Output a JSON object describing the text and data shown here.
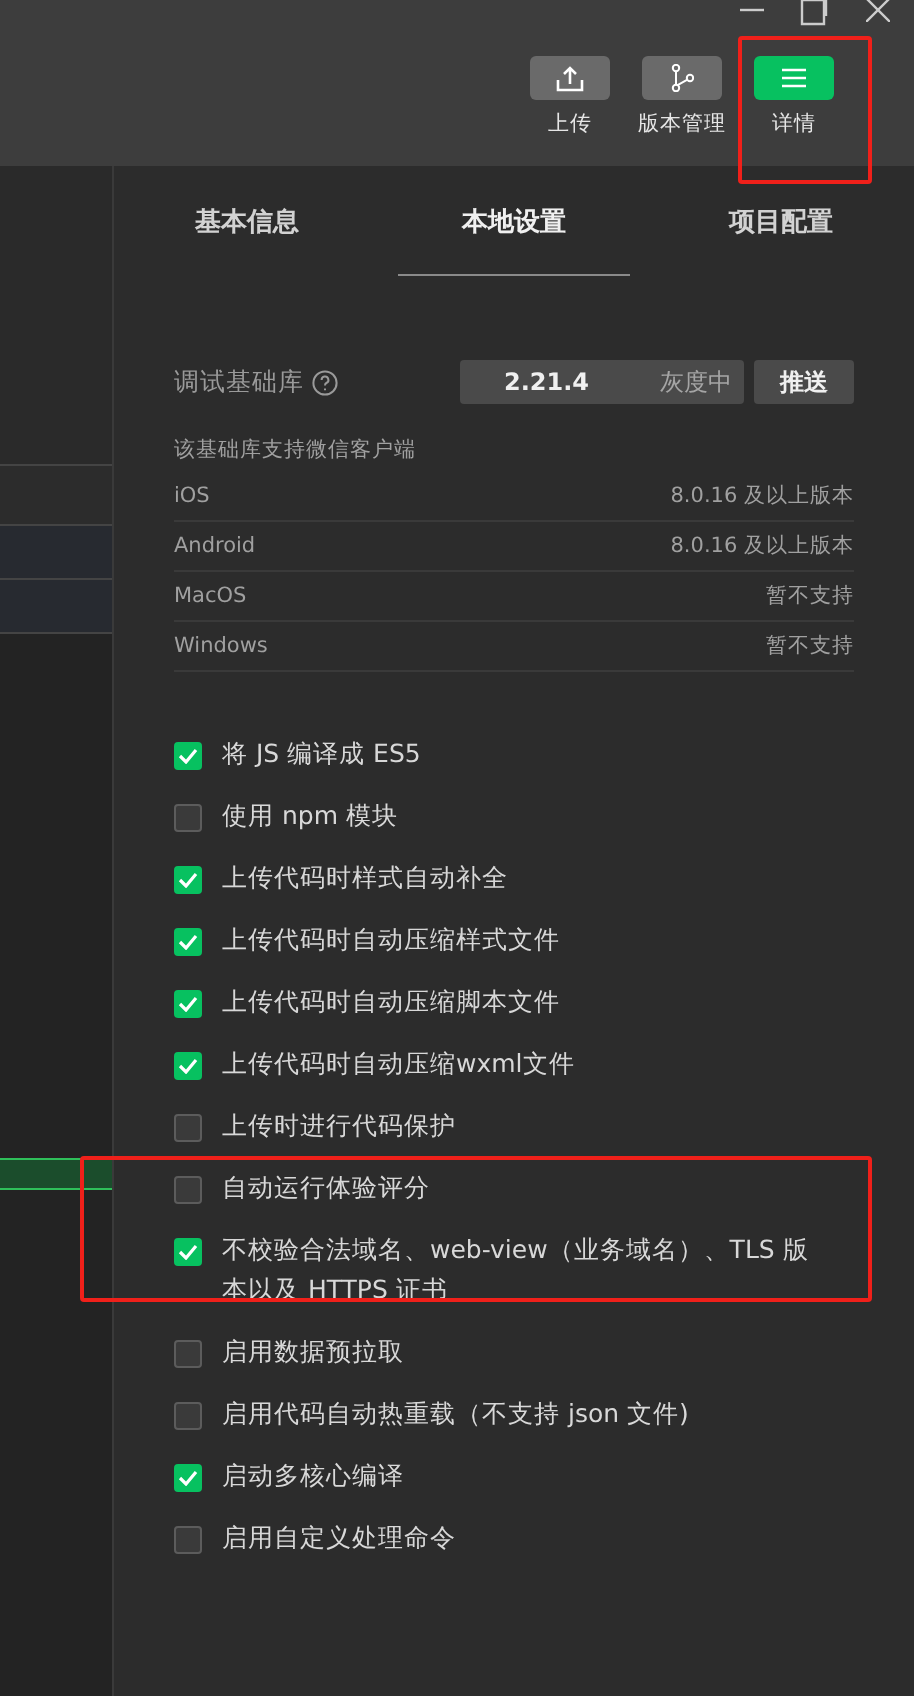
{
  "toolbar": {
    "buttons": [
      {
        "kind": "upload",
        "label": "上传",
        "selected": false
      },
      {
        "kind": "branch",
        "label": "版本管理",
        "selected": false
      },
      {
        "kind": "menu",
        "label": "详情",
        "selected": true
      }
    ]
  },
  "tabs": [
    {
      "label": "基本信息",
      "selected": false
    },
    {
      "label": "本地设置",
      "selected": true
    },
    {
      "label": "项目配置",
      "selected": false
    }
  ],
  "library": {
    "label": "调试基础库",
    "version": "2.21.4",
    "status": "灰度中",
    "button": "推送"
  },
  "support": {
    "title": "该基础库支持微信客户端",
    "rows": [
      {
        "platform": "iOS",
        "value": "8.0.16 及以上版本"
      },
      {
        "platform": "Android",
        "value": "8.0.16 及以上版本"
      },
      {
        "platform": "MacOS",
        "value": "暂不支持"
      },
      {
        "platform": "Windows",
        "value": "暂不支持"
      }
    ]
  },
  "options": [
    {
      "label": "将 JS 编译成 ES5",
      "checked": true
    },
    {
      "label": "使用 npm 模块",
      "checked": false
    },
    {
      "label": "上传代码时样式自动补全",
      "checked": true
    },
    {
      "label": "上传代码时自动压缩样式文件",
      "checked": true
    },
    {
      "label": "上传代码时自动压缩脚本文件",
      "checked": true
    },
    {
      "label": "上传代码时自动压缩wxml文件",
      "checked": true
    },
    {
      "label": "上传时进行代码保护",
      "checked": false
    },
    {
      "label": "自动运行体验评分",
      "checked": false
    },
    {
      "label": "不校验合法域名、web-view（业务域名）、TLS 版本以及 HTTPS 证书",
      "checked": true
    },
    {
      "label": "启用数据预拉取",
      "checked": false
    },
    {
      "label": "启用代码自动热重载（不支持 json 文件)",
      "checked": false
    },
    {
      "label": "启动多核心编译",
      "checked": true
    },
    {
      "label": "启用自定义处理命令",
      "checked": false
    }
  ]
}
